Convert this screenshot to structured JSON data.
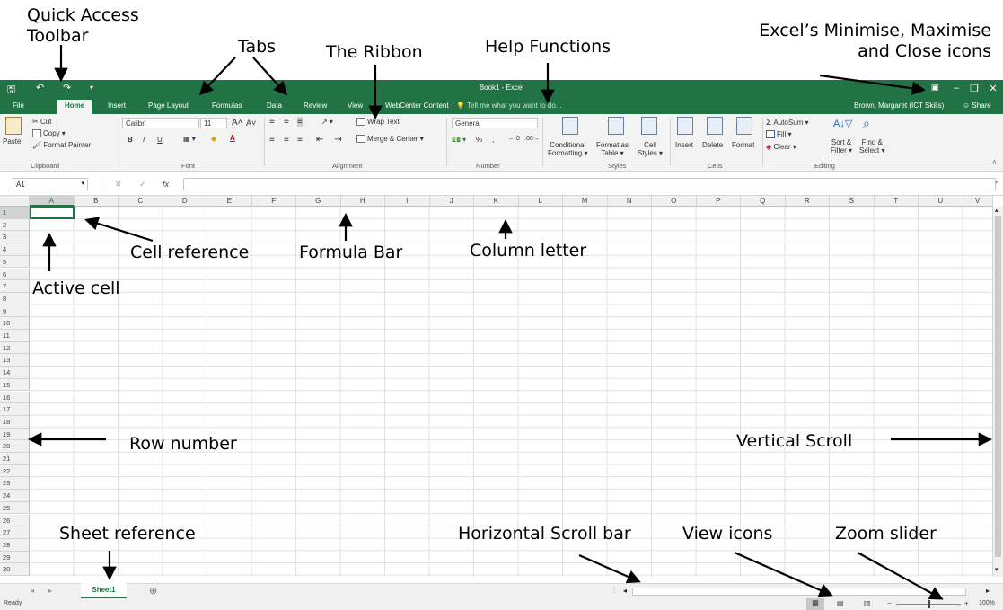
{
  "annotations": {
    "quick_access": [
      "Quick Access",
      "Toolbar"
    ],
    "tabs": "Tabs",
    "ribbon": "The Ribbon",
    "help": "Help Functions",
    "window_controls": [
      "Excel’s Minimise, Maximise",
      "and Close icons"
    ],
    "cell_reference": "Cell reference",
    "formula_bar": "Formula Bar",
    "column_letter": "Column letter",
    "active_cell": "Active cell",
    "row_number": "Row number",
    "vertical_scroll": "Vertical Scroll",
    "sheet_reference": "Sheet reference",
    "horizontal_scroll": "Horizontal Scroll bar",
    "view_icons": "View icons",
    "zoom_slider": "Zoom slider"
  },
  "window": {
    "title": "Book1 - Excel",
    "tabs": [
      "File",
      "Home",
      "Insert",
      "Page Layout",
      "Formulas",
      "Data",
      "Review",
      "View",
      "WebCenter Content"
    ],
    "active_tab": "Home",
    "tell_me": "Tell me what you want to do...",
    "user": "Brown, Margaret (ICT Skills)",
    "share": "Share"
  },
  "ribbon": {
    "clipboard": {
      "paste": "Paste",
      "cut": "Cut",
      "copy": "Copy",
      "format_painter": "Format Painter",
      "label": "Clipboard"
    },
    "font": {
      "name": "Calibri",
      "size": "11",
      "label": "Font"
    },
    "alignment": {
      "wrap": "Wrap Text",
      "merge": "Merge & Center",
      "label": "Alignment"
    },
    "number": {
      "format": "General",
      "label": "Number"
    },
    "styles": {
      "conditional": [
        "Conditional",
        "Formatting"
      ],
      "format_table": [
        "Format as",
        "Table"
      ],
      "cell_styles": [
        "Cell",
        "Styles"
      ],
      "label": "Styles"
    },
    "cells": {
      "insert": "Insert",
      "delete": "Delete",
      "format": "Format",
      "label": "Cells"
    },
    "editing": {
      "autosum": "AutoSum",
      "fill": "Fill",
      "clear": "Clear",
      "sort": [
        "Sort &",
        "Filter"
      ],
      "find": [
        "Find &",
        "Select"
      ],
      "label": "Editing"
    }
  },
  "formula_bar": {
    "name_box": "A1",
    "fx": "fx",
    "value": ""
  },
  "columns": [
    "A",
    "B",
    "C",
    "D",
    "E",
    "F",
    "G",
    "H",
    "I",
    "J",
    "K",
    "L",
    "M",
    "N",
    "O",
    "P",
    "Q",
    "R",
    "S",
    "T",
    "U",
    "V"
  ],
  "rows": [
    "1",
    "2",
    "3",
    "4",
    "5",
    "6",
    "7",
    "8",
    "9",
    "10",
    "11",
    "12",
    "13",
    "14",
    "15",
    "16",
    "17",
    "18",
    "19",
    "20",
    "21",
    "22",
    "23",
    "24",
    "25",
    "26",
    "27",
    "28",
    "29",
    "30"
  ],
  "active_cell": "A1",
  "sheet_tab": "Sheet1",
  "status": {
    "text": "Ready",
    "zoom": "100%"
  },
  "colors": {
    "brand": "#217346",
    "ribbon_bg": "#f3f3f3"
  }
}
